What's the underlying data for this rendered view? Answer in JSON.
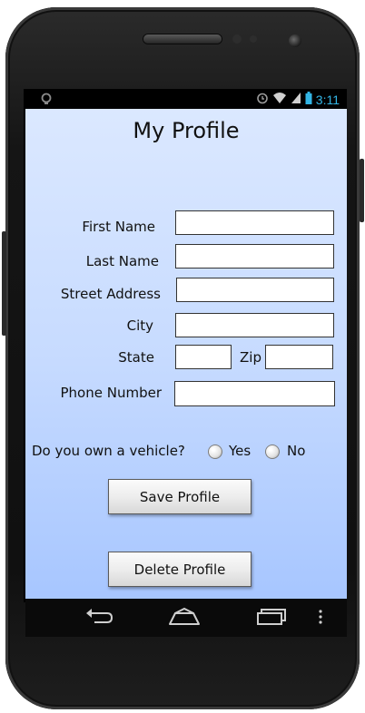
{
  "status_bar": {
    "time": "3:11",
    "icons": [
      "alarm-icon",
      "wifi-icon",
      "signal-icon",
      "battery-icon"
    ],
    "accent": "#33b5e5"
  },
  "profile": {
    "title": "My Profile",
    "fields": {
      "first_name": {
        "label": "First Name",
        "value": ""
      },
      "last_name": {
        "label": "Last Name",
        "value": ""
      },
      "street_address": {
        "label": "Street Address",
        "value": ""
      },
      "city": {
        "label": "City",
        "value": ""
      },
      "state": {
        "label": "State",
        "value": ""
      },
      "zip": {
        "label": "Zip",
        "value": ""
      },
      "phone": {
        "label": "Phone Number",
        "value": ""
      }
    },
    "vehicle": {
      "question": "Do you own a vehicle?",
      "options": [
        "Yes",
        "No"
      ],
      "selected": null
    },
    "save_label": "Save Profile",
    "delete_label": "Delete Profile"
  },
  "navbar": {
    "icons": [
      "back-icon",
      "home-icon",
      "recent-apps-icon",
      "menu-icon"
    ]
  },
  "colors": {
    "background_top": "#dbe8ff",
    "background_bottom": "#a7c6ff"
  }
}
